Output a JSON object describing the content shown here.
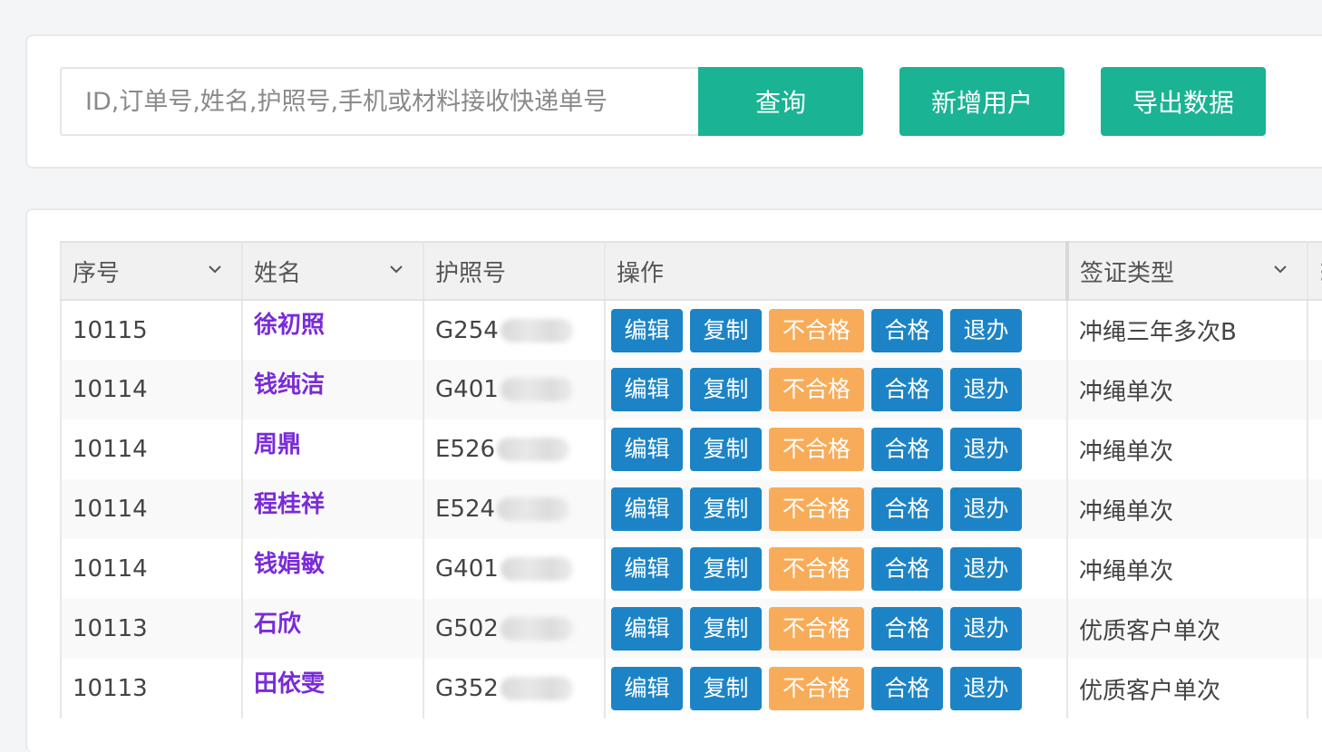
{
  "search": {
    "placeholder": "ID,订单号,姓名,护照号,手机或材料接收快递单号",
    "query_label": "查询",
    "add_user_label": "新增用户",
    "export_label": "导出数据"
  },
  "table": {
    "headers": {
      "seq": "序号",
      "name": "姓名",
      "passport": "护照号",
      "operation": "操作",
      "visa_type": "签证类型"
    },
    "actions": {
      "edit": "编辑",
      "copy": "复制",
      "fail": "不合格",
      "pass": "合格",
      "withdraw": "退办"
    },
    "rows": [
      {
        "seq": "10115",
        "name": "徐初照",
        "passport": "G254",
        "visa_type": "冲绳三年多次B"
      },
      {
        "seq": "10114",
        "name": "钱纯洁",
        "passport": "G401",
        "visa_type": "冲绳单次"
      },
      {
        "seq": "10114",
        "name": "周鼎",
        "passport": "E526",
        "visa_type": "冲绳单次"
      },
      {
        "seq": "10114",
        "name": "程桂祥",
        "passport": "E524",
        "visa_type": "冲绳单次"
      },
      {
        "seq": "10114",
        "name": "钱娟敏",
        "passport": "G401",
        "visa_type": "冲绳单次"
      },
      {
        "seq": "10113",
        "name": "石欣",
        "passport": "G502",
        "visa_type": "优质客户单次"
      },
      {
        "seq": "10113",
        "name": "田依雯",
        "passport": "G352",
        "visa_type": "优质客户单次"
      }
    ]
  },
  "colors": {
    "primary_green": "#1ab394",
    "action_blue": "#1c84c6",
    "action_orange": "#f8ac59",
    "name_purple": "#7a2bd8"
  }
}
